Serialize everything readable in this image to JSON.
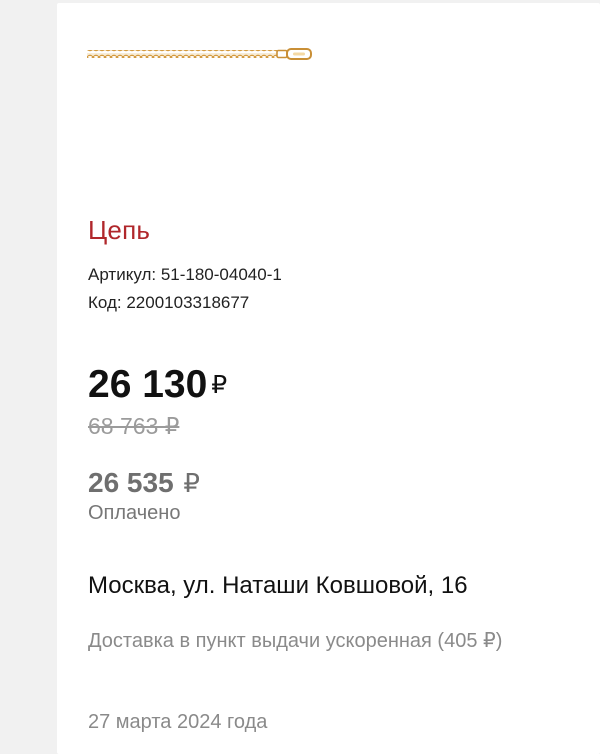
{
  "product": {
    "title": "Цепь",
    "sku_line": "Артикул: 51-180-04040-1",
    "code_line": "Код: 2200103318677",
    "image_name": "gold-chain-image"
  },
  "price": {
    "current_value": "26 130",
    "current_currency": "₽",
    "old": "68 763 ₽"
  },
  "payment": {
    "amount_value": "26 535",
    "amount_currency": "₽",
    "status": "Оплачено"
  },
  "delivery": {
    "address": "Москва, ул. Наташи Ковшовой, 16",
    "method": "Доставка в пункт выдачи ускоренная (405 ₽)",
    "date": "27 марта 2024 года"
  },
  "colors": {
    "title_accent": "#b0272b",
    "background": "#f1f1f1",
    "card": "#ffffff",
    "gold": "#d4a04a"
  }
}
